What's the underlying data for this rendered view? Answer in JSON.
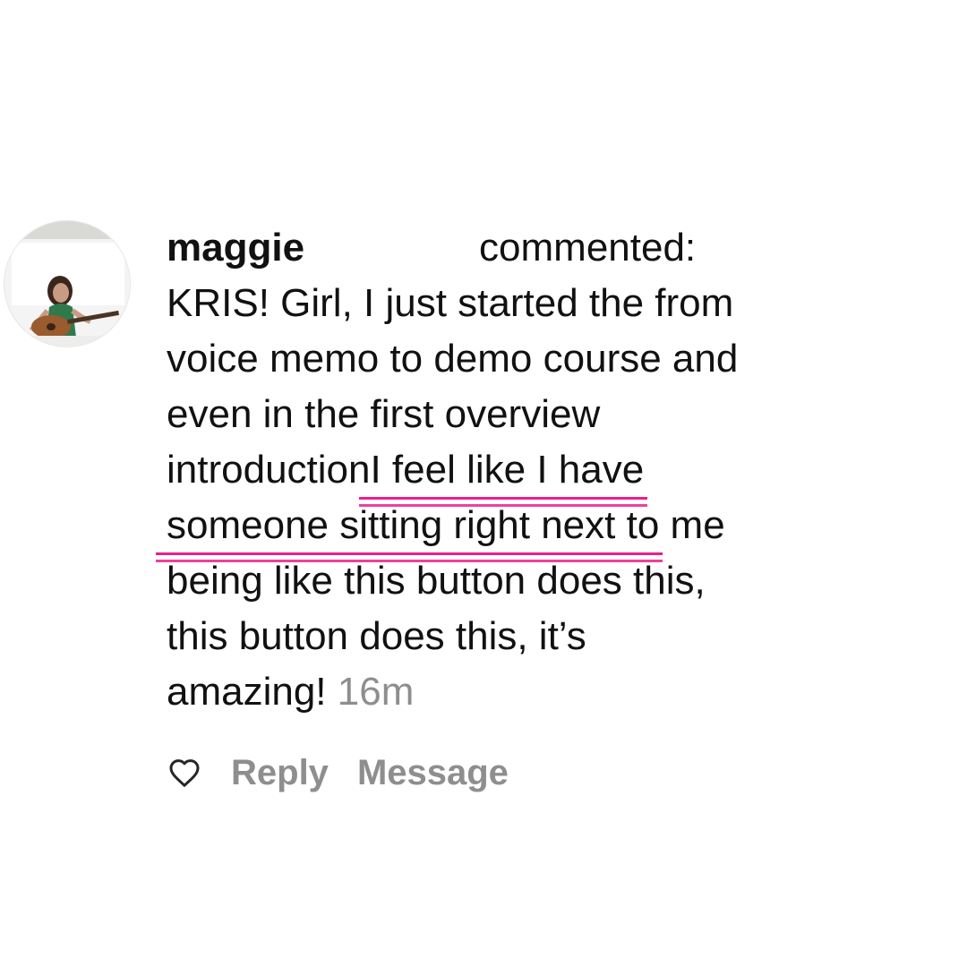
{
  "comment": {
    "username": "maggie",
    "action": "commented:",
    "text_lines": [
      "KRIS! Girl, I just started the from",
      "voice memo to demo course and",
      "even in the first overview"
    ],
    "line4_prefix": "introduction",
    "highlight_part1": " I feel like I have",
    "highlight_part2": "someone sitting right next to",
    "line5_suffix": " me",
    "text_lines_after": [
      "being like this button does this,",
      "this button does this, it’s"
    ],
    "last_line_text": "amazing!",
    "timestamp": "16m"
  },
  "actions": {
    "like_icon": "heart-outline-icon",
    "reply_label": "Reply",
    "message_label": "Message"
  },
  "colors": {
    "highlight_underline": "#ec1e8c",
    "meta_gray": "#8e8e8e"
  }
}
